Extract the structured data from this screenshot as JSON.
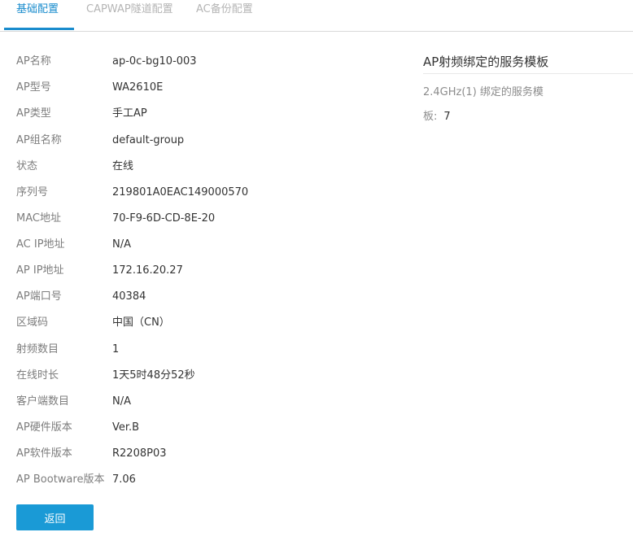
{
  "tabs": [
    {
      "label": "基础配置",
      "active": true
    },
    {
      "label": "CAPWAP隧道配置",
      "active": false
    },
    {
      "label": "AC备份配置",
      "active": false
    }
  ],
  "info": [
    {
      "label": "AP名称",
      "value": "ap-0c-bg10-003"
    },
    {
      "label": "AP型号",
      "value": "WA2610E"
    },
    {
      "label": "AP类型",
      "value": "手工AP"
    },
    {
      "label": "AP组名称",
      "value": "default-group"
    },
    {
      "label": "状态",
      "value": "在线"
    },
    {
      "label": "序列号",
      "value": "219801A0EAC149000570"
    },
    {
      "label": "MAC地址",
      "value": "70-F9-6D-CD-8E-20"
    },
    {
      "label": "AC IP地址",
      "value": "N/A"
    },
    {
      "label": "AP IP地址",
      "value": "172.16.20.27"
    },
    {
      "label": "AP端口号",
      "value": "40384"
    },
    {
      "label": "区域码",
      "value": "中国（CN）"
    },
    {
      "label": "射频数目",
      "value": "1"
    },
    {
      "label": "在线时长",
      "value": "1天5时48分52秒"
    },
    {
      "label": "客户端数目",
      "value": "N/A"
    },
    {
      "label": "AP硬件版本",
      "value": "Ver.B"
    },
    {
      "label": "AP软件版本",
      "value": "R2208P03"
    },
    {
      "label": "AP Bootware版本",
      "value": "7.06"
    }
  ],
  "right_panel": {
    "title": "AP射频绑定的服务模板",
    "item_label": "2.4GHz(1) 绑定的服务模板:",
    "item_value": "7"
  },
  "back_button": {
    "label": "返回"
  },
  "colors": {
    "accent": "#1a8ccd",
    "button": "#1a9ad6",
    "label": "#7d7d7d"
  }
}
